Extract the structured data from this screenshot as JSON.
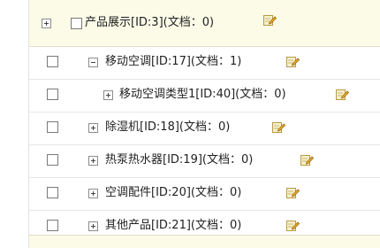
{
  "tree": {
    "items": [
      {
        "id": "root",
        "label": "产品展示[ID:3](文档：0)",
        "toggle": "plus",
        "icon": "edit-pencil-icon"
      },
      {
        "id": "17",
        "label": "移动空调[ID:17](文档：1)",
        "toggle": "minus",
        "icon": "edit-pencil-icon"
      },
      {
        "id": "40",
        "label": "移动空调类型1[ID:40](文档：0)",
        "toggle": "plus",
        "icon": "edit-pencil-icon"
      },
      {
        "id": "18",
        "label": "除湿机[ID:18](文档：0)",
        "toggle": "plus",
        "icon": "edit-pencil-icon"
      },
      {
        "id": "19",
        "label": "热泵热水器[ID:19](文档：0)",
        "toggle": "plus",
        "icon": "edit-pencil-icon"
      },
      {
        "id": "20",
        "label": "空调配件[ID:20](文档：0)",
        "toggle": "plus",
        "icon": "edit-pencil-icon"
      },
      {
        "id": "21",
        "label": "其他产品[ID:21](文档：0)",
        "toggle": "plus",
        "icon": "edit-pencil-icon"
      }
    ]
  },
  "colors": {
    "header_bg": "#fbfbe8",
    "row_border": "#e6e6e6",
    "text": "#222222",
    "checkbox_border": "#7a7a7a"
  }
}
